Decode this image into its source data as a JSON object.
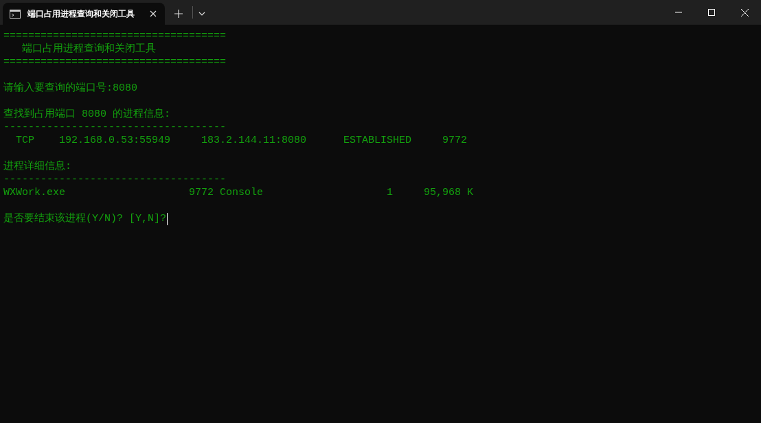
{
  "window": {
    "tab_title": "端口占用进程查询和关闭工具",
    "tab_selected": true
  },
  "terminal": {
    "blocks": [
      [
        {
          "kind": "rule",
          "text": "===================================="
        },
        {
          "kind": "text",
          "text": "   端口占用进程查询和关闭工具"
        },
        {
          "kind": "rule",
          "text": "===================================="
        }
      ],
      [
        {
          "kind": "text",
          "text": "请输入要查询的端口号:8080"
        }
      ],
      [
        {
          "kind": "text",
          "text": "查找到占用端口 8080 的进程信息:"
        },
        {
          "kind": "rule",
          "text": "------------------------------------"
        },
        {
          "kind": "text",
          "text": "  TCP    192.168.0.53:55949     183.2.144.11:8080      ESTABLISHED     9772"
        }
      ],
      [
        {
          "kind": "text",
          "text": "进程详细信息:"
        },
        {
          "kind": "rule",
          "text": "------------------------------------"
        },
        {
          "kind": "text",
          "text": "WXWork.exe                    9772 Console                    1     95,968 K"
        }
      ],
      [
        {
          "kind": "prompt",
          "text": "是否要结束该进程(Y/N)? [Y,N]?"
        }
      ]
    ]
  }
}
